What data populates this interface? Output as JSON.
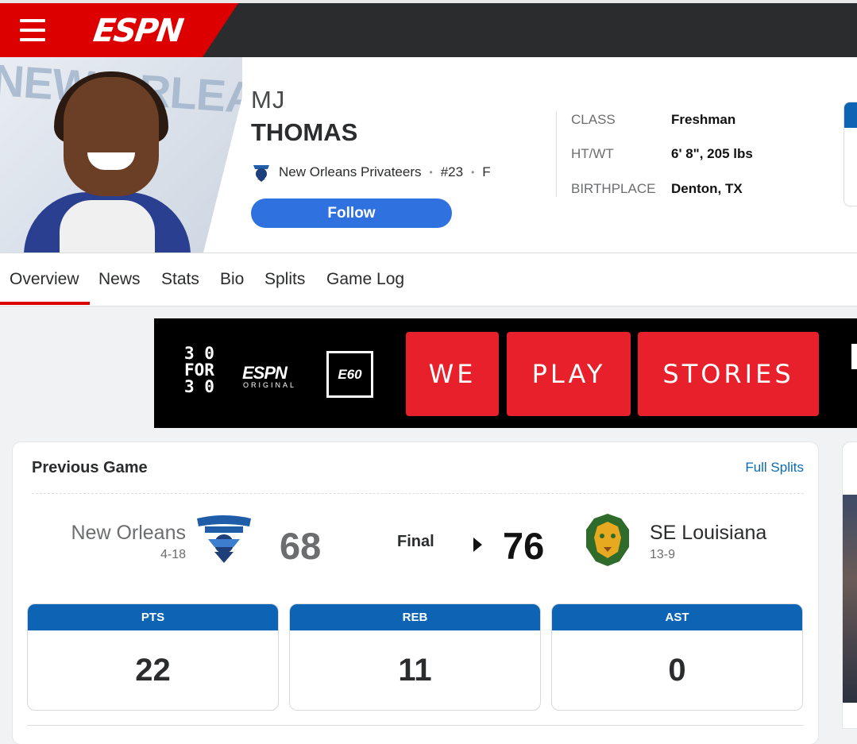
{
  "topbar": {
    "logo_text": "ESPN"
  },
  "player": {
    "first_name": "MJ",
    "last_name": "THOMAS",
    "team": "New Orleans Privateers",
    "number": "#23",
    "position": "F",
    "follow_label": "Follow",
    "headshot_bg_text": "NEW ORLEANS",
    "bio": [
      {
        "label": "CLASS",
        "value": "Freshman"
      },
      {
        "label": "HT/WT",
        "value": "6' 8\", 205 lbs"
      },
      {
        "label": "BIRTHPLACE",
        "value": "Denton, TX"
      }
    ]
  },
  "tabs": [
    {
      "label": "Overview",
      "active": true
    },
    {
      "label": "News"
    },
    {
      "label": "Stats"
    },
    {
      "label": "Bio"
    },
    {
      "label": "Splits"
    },
    {
      "label": "Game Log"
    }
  ],
  "ad": {
    "brand_line1": "3 0",
    "brand_line2": "FOR",
    "brand_line3": "3 0",
    "espn": "ESPN",
    "original": "ORIGINAL",
    "e60": "E60",
    "tiles": [
      "WE",
      "PLAY",
      "STORIES"
    ]
  },
  "previous_game": {
    "title": "Previous Game",
    "link": "Full Splits",
    "away": {
      "name": "New Orleans",
      "record": "4-18",
      "score": "68"
    },
    "home": {
      "name": "SE Louisiana",
      "record": "13-9",
      "score": "76"
    },
    "status": "Final",
    "stats": [
      {
        "label": "PTS",
        "value": "22"
      },
      {
        "label": "REB",
        "value": "11"
      },
      {
        "label": "AST",
        "value": "0"
      }
    ]
  },
  "colors": {
    "espn_red": "#dd0000",
    "follow_blue": "#3071e0",
    "stat_header_blue": "#0e64b4",
    "link_blue": "#0c6bb6"
  }
}
